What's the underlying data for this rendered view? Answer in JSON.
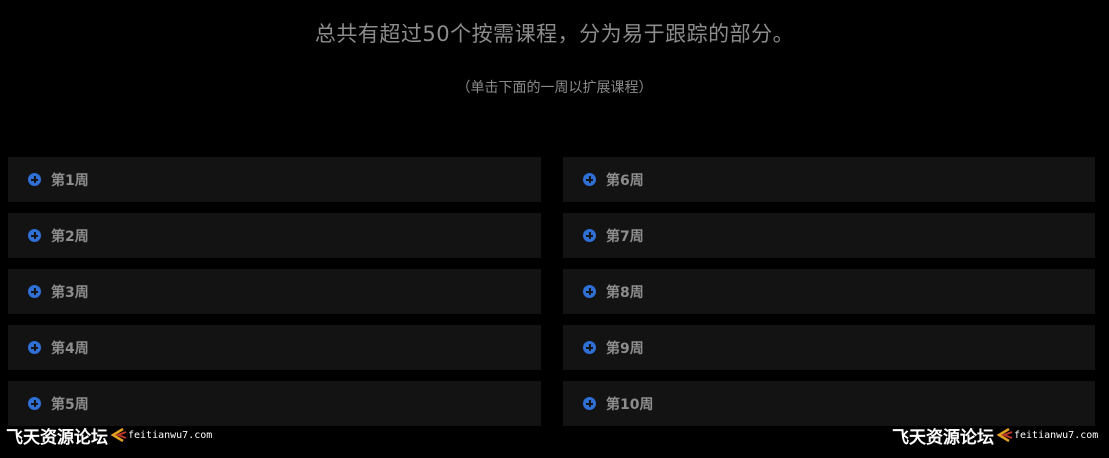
{
  "header": {
    "title": "总共有超过50个按需课程，分为易于跟踪的部分。",
    "hint": "（单击下面的一周以扩展课程）"
  },
  "weeks_left": [
    {
      "label": "第1周",
      "icon": "plus-circle-icon"
    },
    {
      "label": "第2周",
      "icon": "plus-circle-icon"
    },
    {
      "label": "第3周",
      "icon": "plus-circle-icon"
    },
    {
      "label": "第4周",
      "icon": "plus-circle-icon"
    },
    {
      "label": "第5周",
      "icon": "plus-circle-icon"
    }
  ],
  "weeks_right": [
    {
      "label": "第6周",
      "icon": "plus-circle-icon"
    },
    {
      "label": "第7周",
      "icon": "plus-circle-icon"
    },
    {
      "label": "第8周",
      "icon": "plus-circle-icon"
    },
    {
      "label": "第9周",
      "icon": "plus-circle-icon"
    },
    {
      "label": "第10周",
      "icon": "plus-circle-icon"
    }
  ],
  "watermark": {
    "site_name": "飞天资源论坛",
    "url": "feitianwu7.com"
  },
  "colors": {
    "background": "#000000",
    "panel": "#131313",
    "accent": "#2f6fd6",
    "text": "#8d8d8d"
  }
}
